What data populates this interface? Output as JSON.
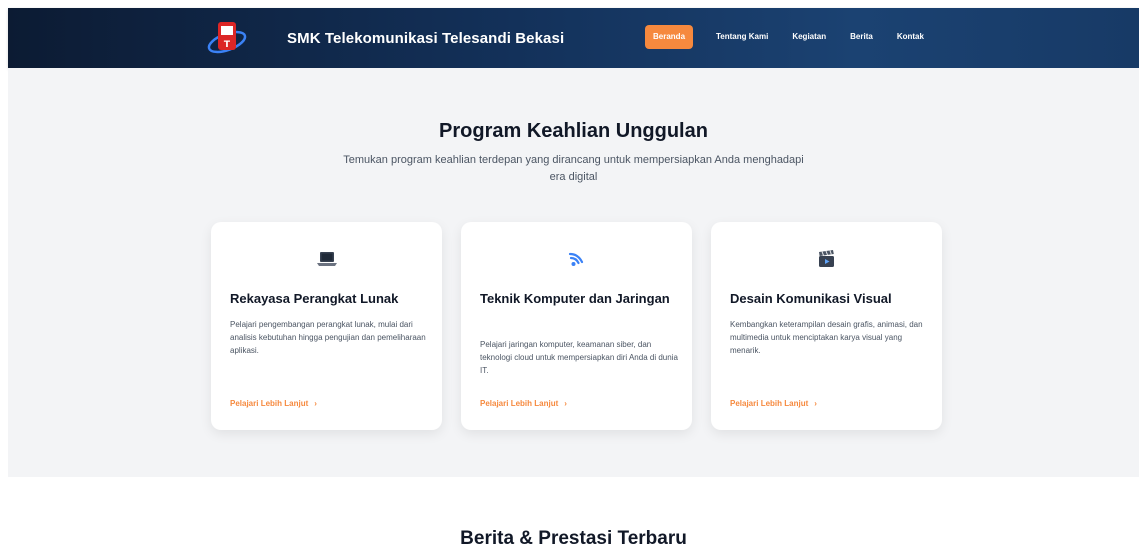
{
  "header": {
    "school_name": "SMK Telekomunikasi Telesandi Bekasi",
    "nav": [
      {
        "label": "Beranda",
        "active": true
      },
      {
        "label": "Tentang Kami"
      },
      {
        "label": "Kegiatan"
      },
      {
        "label": "Berita"
      },
      {
        "label": "Kontak"
      }
    ],
    "colors": {
      "bar": "#13315a",
      "accent": "#f6893e"
    }
  },
  "program": {
    "title": "Program Keahlian Unggulan",
    "subtitle": "Temukan program keahlian terdepan yang dirancang untuk mempersiapkan Anda menghadapi era digital",
    "cards": [
      {
        "icon": "laptop-icon",
        "title": "Rekayasa Perangkat Lunak",
        "description": "Pelajari pengembangan perangkat lunak, mulai dari analisis kebutuhan hingga pengujian dan pemeliharaan aplikasi.",
        "link": "Pelajari Lebih Lanjut"
      },
      {
        "icon": "wifi-icon",
        "title": "Teknik Komputer dan Jaringan",
        "description": "Pelajari jaringan komputer, keamanan siber, dan teknologi cloud untuk mempersiapkan diri Anda di dunia IT.",
        "link": "Pelajari Lebih Lanjut"
      },
      {
        "icon": "clapperboard-icon",
        "title": "Desain Komunikasi Visual",
        "description": "Kembangkan keterampilan desain grafis, animasi, dan multimedia untuk menciptakan karya visual yang menarik.",
        "link": "Pelajari Lebih Lanjut"
      }
    ]
  },
  "news": {
    "title": "Berita & Prestasi Terbaru"
  }
}
